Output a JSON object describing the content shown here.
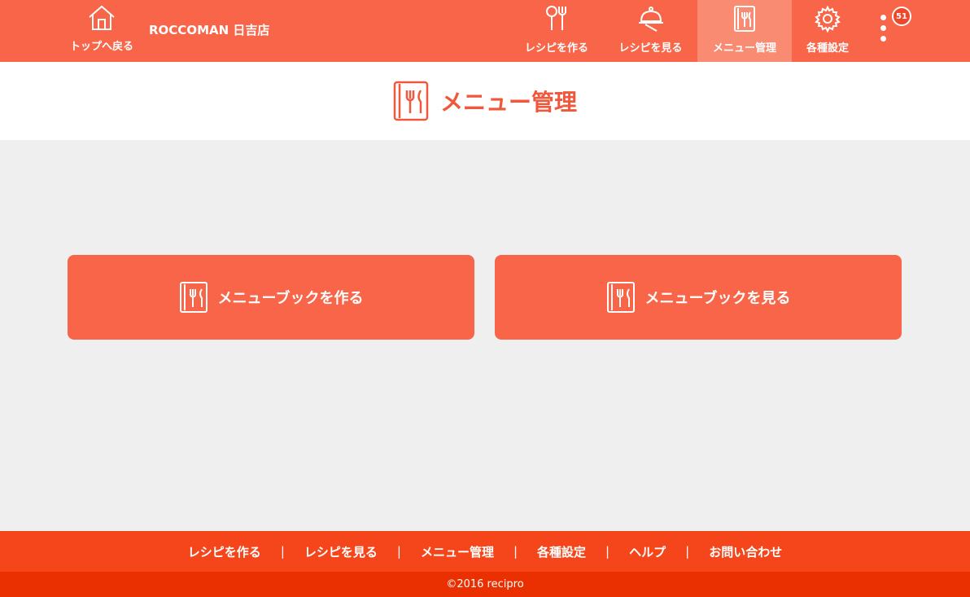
{
  "header": {
    "home_label": "トップへ戻る",
    "shop_name": "ROCCOMAN 日吉店",
    "nav": [
      {
        "label": "レシピを作る",
        "icon": "utensils-icon"
      },
      {
        "label": "レシピを見る",
        "icon": "cloche-icon"
      },
      {
        "label": "メニュー管理",
        "icon": "menu-book-icon",
        "active": true
      },
      {
        "label": "各種設定",
        "icon": "gear-icon"
      }
    ],
    "badge_count": "51"
  },
  "page": {
    "title": "メニュー管理"
  },
  "actions": {
    "make_label": "メニューブックを作る",
    "view_label": "メニューブックを見る"
  },
  "footer": {
    "links": [
      "レシピを作る",
      "レシピを見る",
      "メニュー管理",
      "各種設定",
      "ヘルプ",
      "お問い合わせ"
    ],
    "separator": "|",
    "copyright": "©2016 recipro"
  },
  "colors": {
    "header": "#f86548",
    "active_nav": "#fa8b73",
    "title": "#f0583c",
    "footer_nav": "#f5461b",
    "footer_copy": "#ea3000",
    "background": "#efefef"
  }
}
